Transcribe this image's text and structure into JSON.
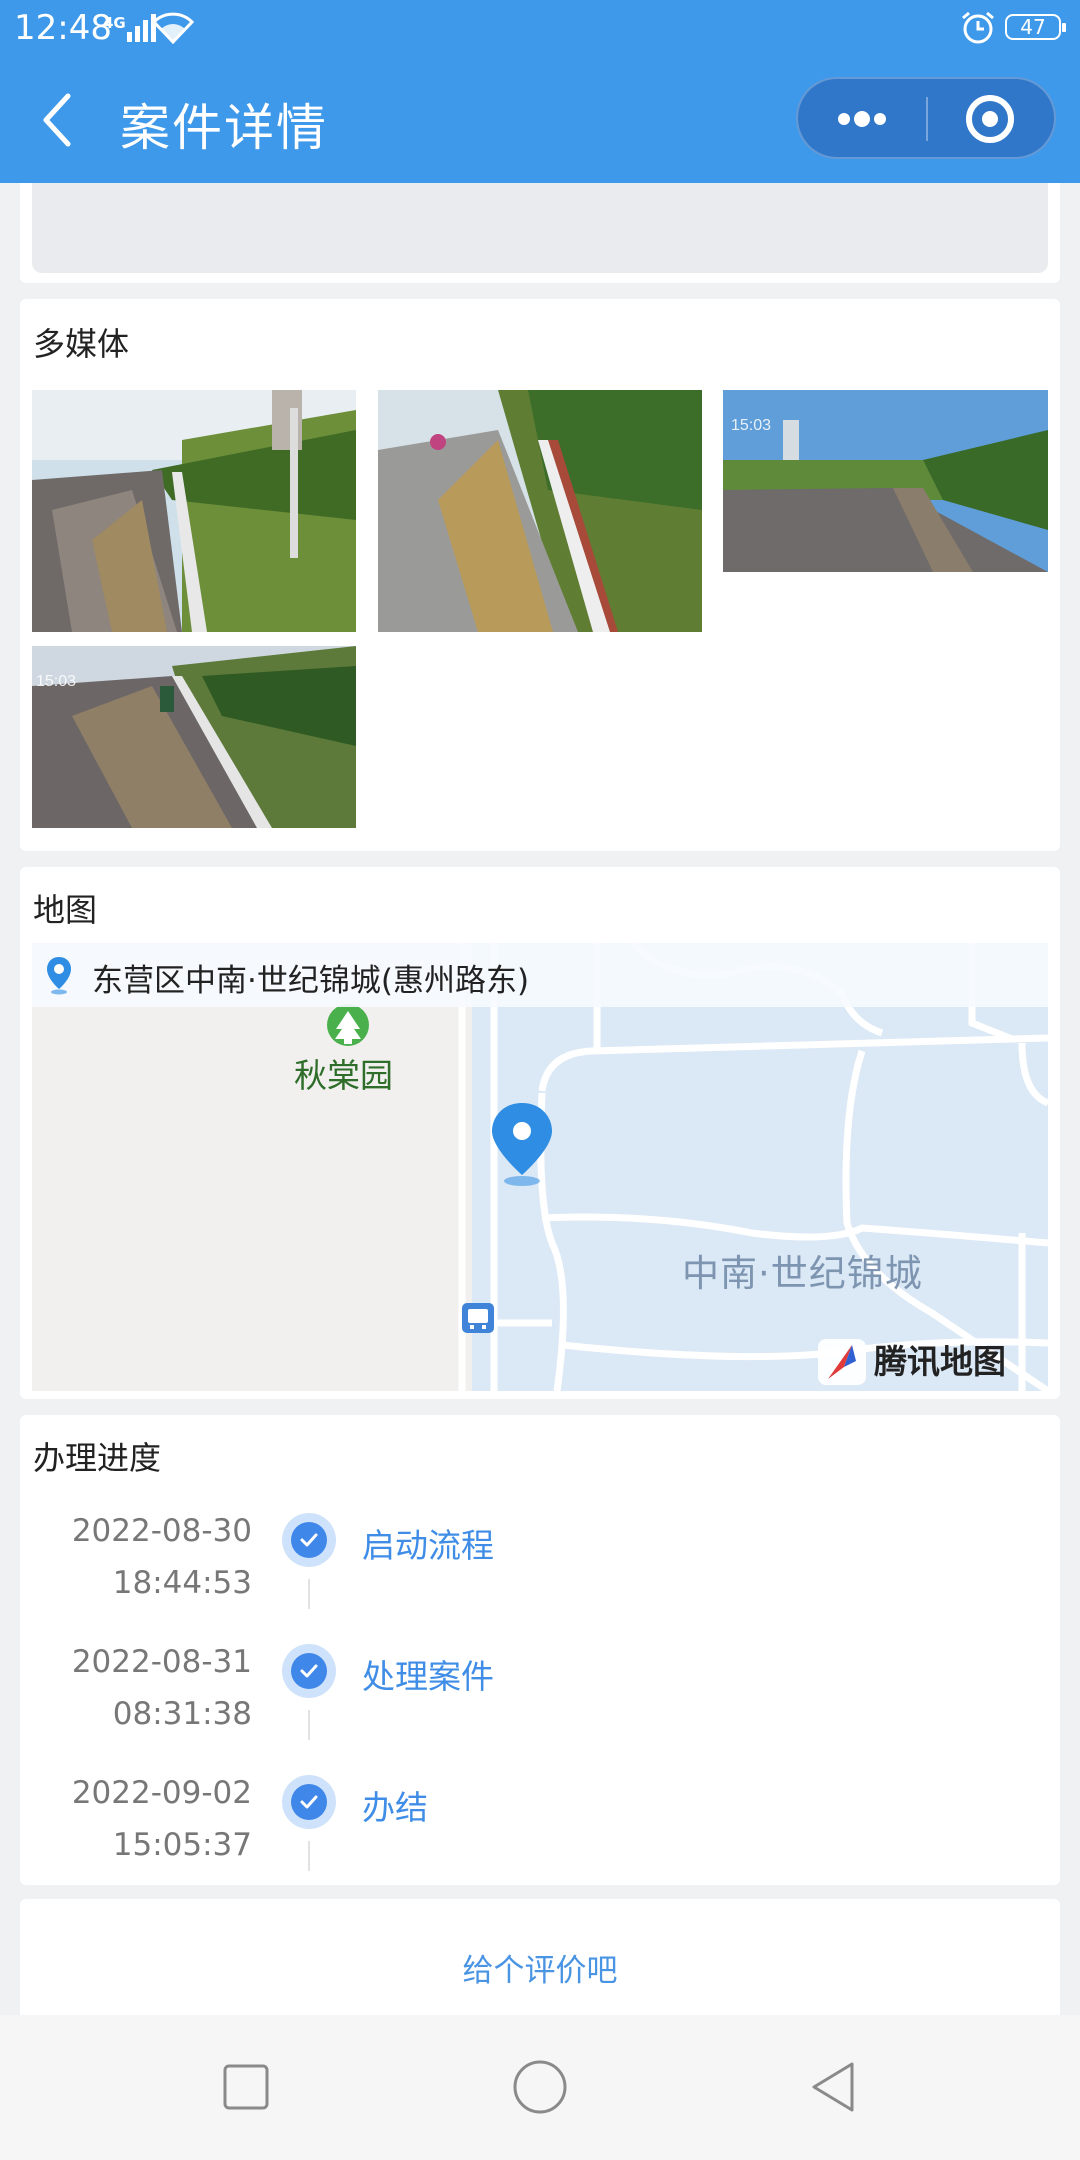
{
  "status_bar": {
    "time": "12:48",
    "network": "4G",
    "battery": "47"
  },
  "header": {
    "title": "案件详情"
  },
  "sections": {
    "media": {
      "title": "多媒体",
      "photo_stamps": [
        "15:03",
        "15:03"
      ]
    },
    "map": {
      "title": "地图",
      "address": "东营区中南·世纪锦城(惠州路东)",
      "poi_park": "秋棠园",
      "poi_area": "中南·世纪锦城",
      "brand": "腾讯地图"
    },
    "progress": {
      "title": "办理进度",
      "steps": [
        {
          "date": "2022-08-30",
          "time": "18:44:53",
          "label": "启动流程"
        },
        {
          "date": "2022-08-31",
          "time": "08:31:38",
          "label": "处理案件"
        },
        {
          "date": "2022-09-02",
          "time": "15:05:37",
          "label": "办结"
        }
      ]
    },
    "rating": {
      "label": "给个评价吧"
    }
  },
  "colors": {
    "header": "#3f99ea",
    "accent": "#3f8de6",
    "background": "#f0f1f3"
  }
}
